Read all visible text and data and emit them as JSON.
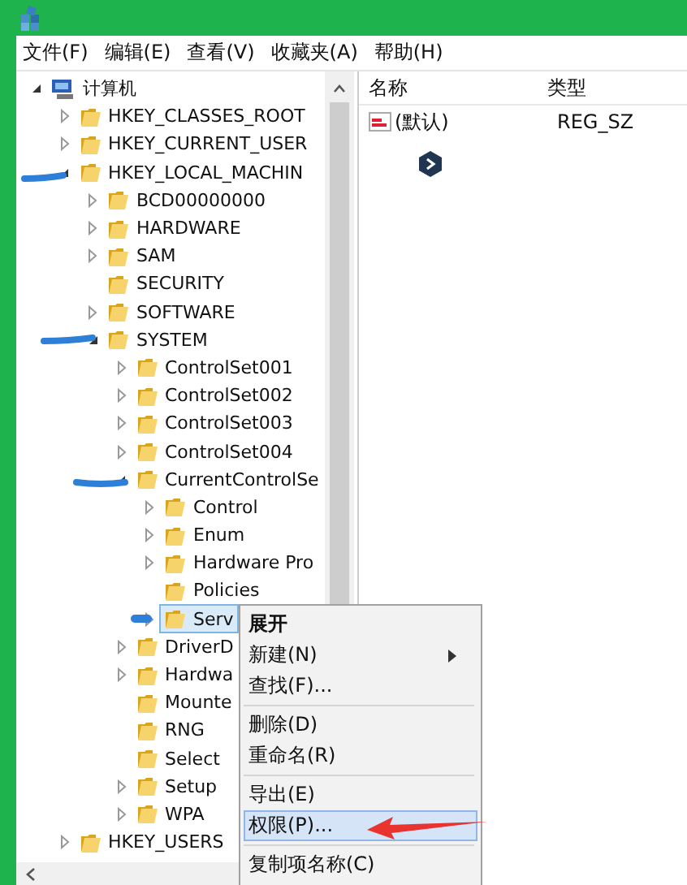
{
  "menu_bar": [
    {
      "label": "文件(F)"
    },
    {
      "label": "编辑(E)"
    },
    {
      "label": "查看(V)"
    },
    {
      "label": "收藏夹(A)"
    },
    {
      "label": "帮助(H)"
    }
  ],
  "tree": [
    {
      "label": "计算机",
      "kind": "computer",
      "expanded": true,
      "selected": false,
      "children": [
        {
          "label": "HKEY_CLASSES_ROOT",
          "expanded": false,
          "selected": false
        },
        {
          "label": "HKEY_CURRENT_USER",
          "expanded": false,
          "selected": false
        },
        {
          "label": "HKEY_LOCAL_MACHIN",
          "expanded": true,
          "selected": false,
          "children": [
            {
              "label": "BCD00000000",
              "expanded": false,
              "selected": false
            },
            {
              "label": "HARDWARE",
              "expanded": false,
              "selected": false
            },
            {
              "label": "SAM",
              "expanded": false,
              "selected": false
            },
            {
              "label": "SECURITY",
              "selected": false
            },
            {
              "label": "SOFTWARE",
              "expanded": false,
              "selected": false
            },
            {
              "label": "SYSTEM",
              "expanded": true,
              "selected": false,
              "children": [
                {
                  "label": "ControlSet001",
                  "expanded": false,
                  "selected": false
                },
                {
                  "label": "ControlSet002",
                  "expanded": false,
                  "selected": false
                },
                {
                  "label": "ControlSet003",
                  "expanded": false,
                  "selected": false
                },
                {
                  "label": "ControlSet004",
                  "expanded": false,
                  "selected": false
                },
                {
                  "label": "CurrentControlSe",
                  "expanded": true,
                  "selected": false,
                  "children": [
                    {
                      "label": "Control",
                      "expanded": false,
                      "selected": false
                    },
                    {
                      "label": "Enum",
                      "expanded": false,
                      "selected": false
                    },
                    {
                      "label": "Hardware Pro",
                      "expanded": false,
                      "selected": false
                    },
                    {
                      "label": "Policies",
                      "selected": false
                    },
                    {
                      "label": "Serv",
                      "expanded": false,
                      "selected": true
                    }
                  ]
                },
                {
                  "label": "DriverD",
                  "expanded": false,
                  "selected": false
                },
                {
                  "label": "Hardwa",
                  "expanded": false,
                  "selected": false
                },
                {
                  "label": "Mounte",
                  "selected": false
                },
                {
                  "label": "RNG",
                  "selected": false
                },
                {
                  "label": "Select",
                  "selected": false
                },
                {
                  "label": "Setup",
                  "expanded": false,
                  "selected": false
                },
                {
                  "label": "WPA",
                  "expanded": false,
                  "selected": false
                }
              ]
            }
          ]
        },
        {
          "label": "HKEY_USERS",
          "expanded": false,
          "selected": false
        }
      ]
    }
  ],
  "values_table": {
    "columns": [
      "名称",
      "类型"
    ],
    "rows": [
      {
        "name": "(默认)",
        "type": "REG_SZ"
      }
    ]
  },
  "context_menu": {
    "groups": [
      [
        {
          "label": "展开",
          "default": true,
          "submenu": false,
          "selected": false
        },
        {
          "label": "新建(N)",
          "default": false,
          "submenu": true,
          "selected": false
        },
        {
          "label": "查找(F)...",
          "default": false,
          "submenu": false,
          "selected": false
        }
      ],
      [
        {
          "label": "删除(D)",
          "default": false,
          "submenu": false,
          "selected": false
        },
        {
          "label": "重命名(R)",
          "default": false,
          "submenu": false,
          "selected": false
        }
      ],
      [
        {
          "label": "导出(E)",
          "default": false,
          "submenu": false,
          "selected": false
        },
        {
          "label": "权限(P)...",
          "default": false,
          "submenu": false,
          "selected": true
        }
      ],
      [
        {
          "label": "复制项名称(C)",
          "default": false,
          "submenu": false,
          "selected": false
        }
      ]
    ]
  }
}
